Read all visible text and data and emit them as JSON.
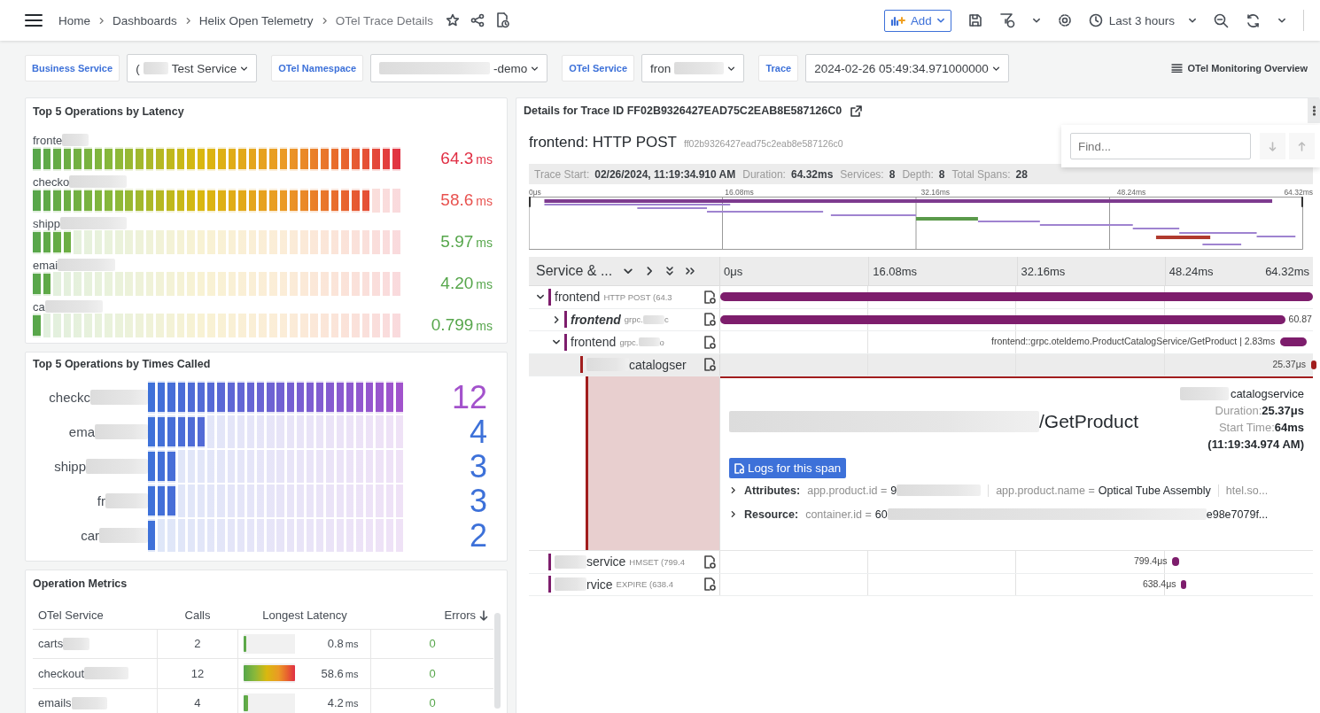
{
  "topbar": {
    "breadcrumbs": [
      "Home",
      "Dashboards",
      "Helix Open Telemetry",
      "OTel Trace Details"
    ],
    "add_label": "Add",
    "time_range": "Last 3 hours"
  },
  "variables": [
    {
      "label": "Business Service",
      "value": {
        "before": "(",
        "redacted": true,
        "after": "Test Service"
      }
    },
    {
      "label": "OTel Namespace",
      "value": {
        "redacted": true,
        "after": "-demo"
      }
    },
    {
      "label": "OTel Service",
      "value": {
        "before": "fron",
        "redacted": true
      }
    },
    {
      "label": "Trace",
      "value": {
        "before": "2024-02-26 05:49:34.971000000"
      }
    }
  ],
  "overview_link": "OTel Monitoring Overview",
  "latency_panel": {
    "title": "Top 5 Operations by Latency",
    "rows": [
      {
        "name": {
          "before": "fronte",
          "redacted": true
        },
        "level": 1.0,
        "value": "64.3",
        "unit": "ms",
        "color": "#e02f44"
      },
      {
        "name": {
          "before": "checko",
          "redacted": true
        },
        "level": 0.917,
        "value": "58.6",
        "unit": "ms",
        "color": "#e8524f"
      },
      {
        "name": {
          "before": "shipp",
          "redacted": true
        },
        "level": 0.111,
        "value": "5.97",
        "unit": "ms",
        "color": "#56a64b"
      },
      {
        "name": {
          "before": "emai",
          "redacted": true
        },
        "level": 0.056,
        "value": "4.20",
        "unit": "ms",
        "color": "#56a64b"
      },
      {
        "name": {
          "before": "ca",
          "redacted": true
        },
        "level": 0.028,
        "value": "0.799",
        "unit": "ms",
        "color": "#56a64b"
      }
    ]
  },
  "calls_panel": {
    "title": "Top 5 Operations by Times Called",
    "rows": [
      {
        "name": {
          "before": "checkc",
          "redacted": true
        },
        "level": 1.0,
        "value": "12",
        "color": "#a352cc"
      },
      {
        "name": {
          "before": "ema",
          "redacted": true
        },
        "level": 0.231,
        "value": "4",
        "color": "#3d71d9"
      },
      {
        "name": {
          "before": "shipp",
          "redacted": true
        },
        "level": 0.115,
        "value": "3",
        "color": "#3d71d9"
      },
      {
        "name": {
          "before": "fr",
          "redacted": true
        },
        "level": 0.115,
        "value": "3",
        "color": "#3d71d9"
      },
      {
        "name": {
          "before": "car",
          "redacted": true
        },
        "level": 0.038,
        "value": "2",
        "color": "#3d71d9"
      }
    ]
  },
  "metrics_panel": {
    "title": "Operation Metrics",
    "columns": [
      {
        "label": "OTel Service",
        "sorted": false
      },
      {
        "label": "Calls",
        "sorted": false
      },
      {
        "label": "Longest Latency",
        "sorted": false
      },
      {
        "label": "Errors",
        "sorted": true
      }
    ],
    "rows": [
      {
        "service": {
          "before": "carts",
          "redacted": true
        },
        "calls": "2",
        "latency": {
          "level": 0.02,
          "value": "0.8",
          "unit": "ms"
        },
        "errors": "0"
      },
      {
        "service": {
          "before": "checkout",
          "redacted": true
        },
        "calls": "12",
        "latency": {
          "level": 1.0,
          "value": "58.6",
          "unit": "ms"
        },
        "errors": "0"
      },
      {
        "service": {
          "before": "emails",
          "redacted": true
        },
        "calls": "4",
        "latency": {
          "level": 0.07,
          "value": "4.2",
          "unit": "ms"
        },
        "errors": "0"
      }
    ]
  },
  "trace_panel": {
    "title": "Details for Trace ID FF02B9326427EAD75C2EAB8E587126C0",
    "find_placeholder": "Find...",
    "trace_name": "frontend: HTTP POST",
    "trace_id": "ff02b9326427ead75c2eab8e587126c0",
    "stats": [
      {
        "label": "Trace Start:",
        "value": "02/26/2024, 11:19:34.910 AM"
      },
      {
        "label": "Duration:",
        "value": "64.32ms"
      },
      {
        "label": "Services:",
        "value": "8"
      },
      {
        "label": "Depth:",
        "value": "8"
      },
      {
        "label": "Total Spans:",
        "value": "28"
      }
    ],
    "minimap_ticks": [
      "0μs",
      "16.08ms",
      "32.16ms",
      "48.24ms",
      "64.32ms"
    ],
    "ticks": [
      "0μs",
      "16.08ms",
      "32.16ms",
      "48.24ms",
      "64.32ms"
    ],
    "column_header": "Service & ...",
    "spans": [
      {
        "service": {
          "before": "frontend"
        },
        "operation": {
          "before": "HTTP POST (64.3"
        },
        "emphasized": false,
        "selected": false,
        "expanded": true,
        "color": "#7d1d6c",
        "children": [
          {
            "service": {
              "before": "frontend"
            },
            "operation": {
              "before": "grpc.",
              "redacted": true,
              "after": "c"
            },
            "emphasized": true,
            "selected": false,
            "expanded": false,
            "color": "#7d1d6c",
            "bar_label": "60.87"
          },
          {
            "service": {
              "before": "frontend"
            },
            "operation": {
              "before": "grpc.",
              "redacted": true,
              "after": "o"
            },
            "emphasized": false,
            "selected": false,
            "expanded": true,
            "color": "#7d1d6c",
            "bar_label": "frontend::grpc.oteldemo.ProductCatalogService/GetProduct | 2.83ms",
            "children": [
              {
                "service": {
                  "redacted": true,
                  "after": "catalogser"
                },
                "emphasized": false,
                "selected": true,
                "color": "#a11d1d",
                "bar_label": "25.37μs",
                "detail": {
                  "operation": {
                    "redacted": true,
                    "after": "/GetProduct"
                  },
                  "service": {
                    "redacted": true,
                    "after": "catalogservice"
                  },
                  "stats": [
                    {
                      "label": "Duration:",
                      "value": "25.37μs"
                    },
                    {
                      "label": "Start Time:",
                      "value": "64ms"
                    }
                  ],
                  "start_clock": "(11:19:34.974 AM)",
                  "logs_button": "Logs for this span",
                  "sections": [
                    {
                      "label": "Attributes:",
                      "expanded": false,
                      "items": [
                        {
                          "key": "app.product.id =",
                          "value": {
                            "before": "9",
                            "redacted": true
                          }
                        },
                        {
                          "key": "app.product.name =",
                          "value": {
                            "before": "Optical Tube Assembly"
                          }
                        },
                        {
                          "key": "htel.so..."
                        }
                      ]
                    },
                    {
                      "label": "Resource:",
                      "expanded": false,
                      "items": [
                        {
                          "key": "container.id =",
                          "value": {
                            "before": "60",
                            "redacted": true,
                            "after": "e98e7079f..."
                          }
                        }
                      ]
                    }
                  ]
                }
              }
            ]
          }
        ]
      },
      {
        "service": {
          "redacted": true,
          "after": "service"
        },
        "operation": {
          "before": "HMSET (799.4"
        },
        "emphasized": false,
        "selected": false,
        "color": "#7d1d6c",
        "bar_label": "799.4μs"
      },
      {
        "service": {
          "redacted": true,
          "after": "rvice"
        },
        "operation": {
          "before": "EXPIRE (638.4"
        },
        "emphasized": false,
        "selected": false,
        "color": "#7d1d6c",
        "bar_label": "638.4μs"
      }
    ]
  }
}
